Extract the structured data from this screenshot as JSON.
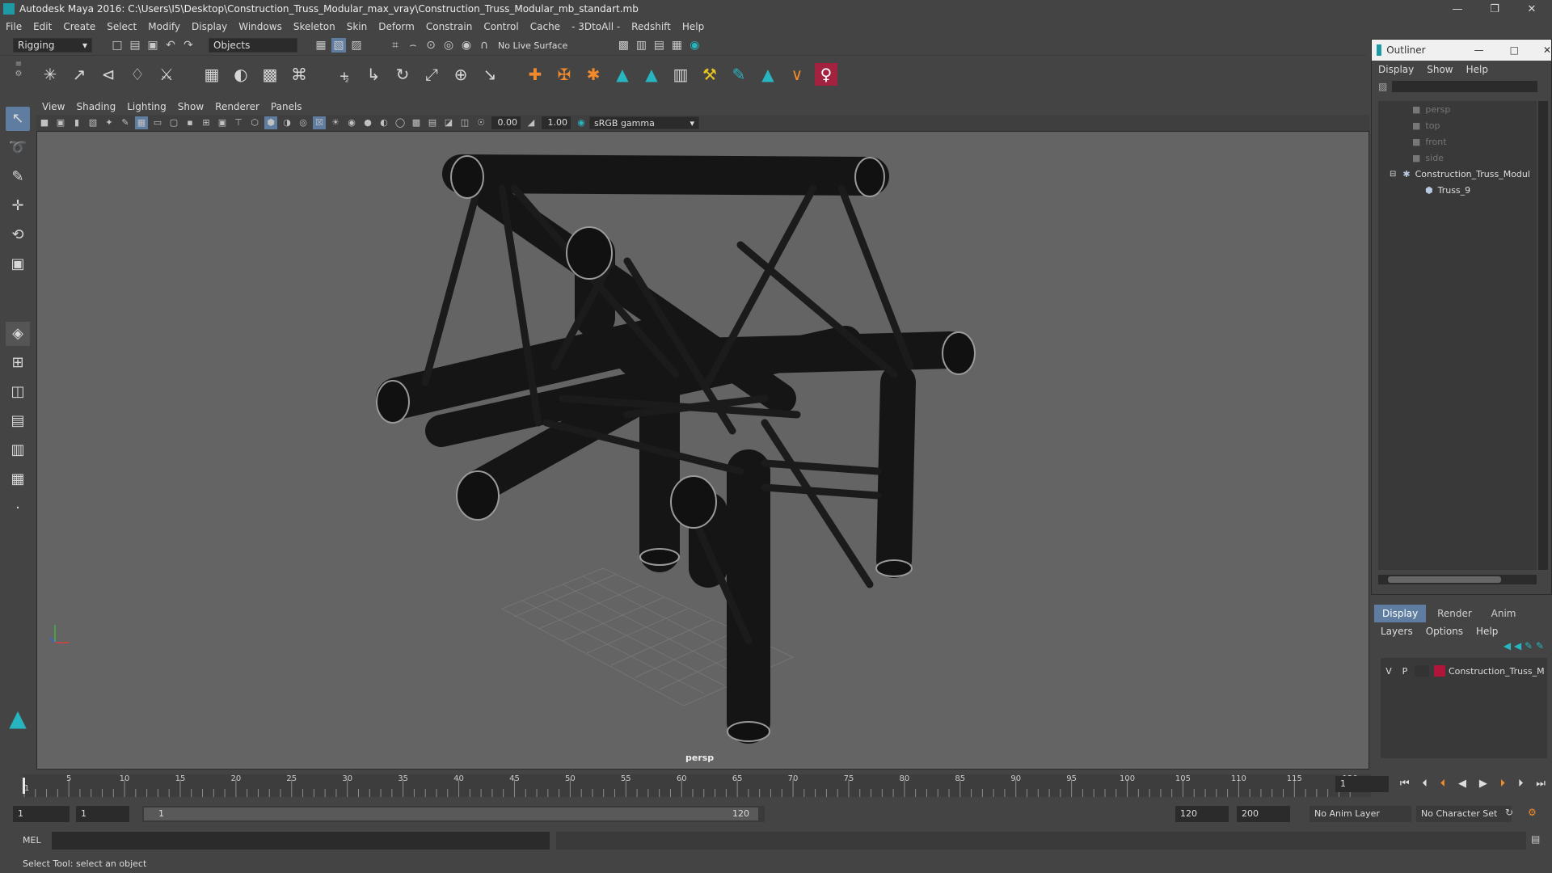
{
  "window": {
    "title": "Autodesk Maya 2016: C:\\Users\\I5\\Desktop\\Construction_Truss_Modular_max_vray\\Construction_Truss_Modular_mb_standart.mb"
  },
  "menubar": [
    "File",
    "Edit",
    "Create",
    "Select",
    "Modify",
    "Display",
    "Windows",
    "Skeleton",
    "Skin",
    "Deform",
    "Constrain",
    "Control",
    "Cache",
    "- 3DtoAll -",
    "Redshift",
    "Help"
  ],
  "statusline": {
    "mode": "Rigging",
    "selection_mode": "Objects",
    "live_surface": "No Live Surface"
  },
  "panel": {
    "menus": [
      "View",
      "Shading",
      "Lighting",
      "Show",
      "Renderer",
      "Panels"
    ],
    "exposure": "0.00",
    "gamma": "1.00",
    "color_space": "sRGB gamma",
    "camera_label": "persp"
  },
  "outliner": {
    "title": "Outliner",
    "menus": [
      "Display",
      "Show",
      "Help"
    ],
    "items": [
      {
        "name": "persp",
        "kind": "camera"
      },
      {
        "name": "top",
        "kind": "camera"
      },
      {
        "name": "front",
        "kind": "camera"
      },
      {
        "name": "side",
        "kind": "camera"
      },
      {
        "name": "Construction_Truss_Modul",
        "kind": "group"
      },
      {
        "name": "Truss_9",
        "kind": "mesh"
      }
    ]
  },
  "layers": {
    "tabs": [
      "Display",
      "Render",
      "Anim"
    ],
    "menus": [
      "Layers",
      "Options",
      "Help"
    ],
    "row": {
      "v": "V",
      "p": "P",
      "name": "Construction_Truss_M",
      "color": "#b0163a"
    }
  },
  "timeslider": {
    "ticks": [
      "5",
      "10",
      "15",
      "20",
      "25",
      "30",
      "35",
      "40",
      "45",
      "50",
      "55",
      "60",
      "65",
      "70",
      "75",
      "80",
      "85",
      "90",
      "95",
      "100",
      "105",
      "110",
      "115",
      "120"
    ],
    "start_tick": "1",
    "current_frame": "1"
  },
  "range": {
    "start": "1",
    "playback_start": "1",
    "range_start_label": "1",
    "range_end_label": "120",
    "playback_end": "120",
    "end": "200",
    "anim_layer": "No Anim Layer",
    "character_set": "No Character Set"
  },
  "cmdline": {
    "label": "MEL"
  },
  "helpline": {
    "text": "Select Tool: select an object"
  }
}
